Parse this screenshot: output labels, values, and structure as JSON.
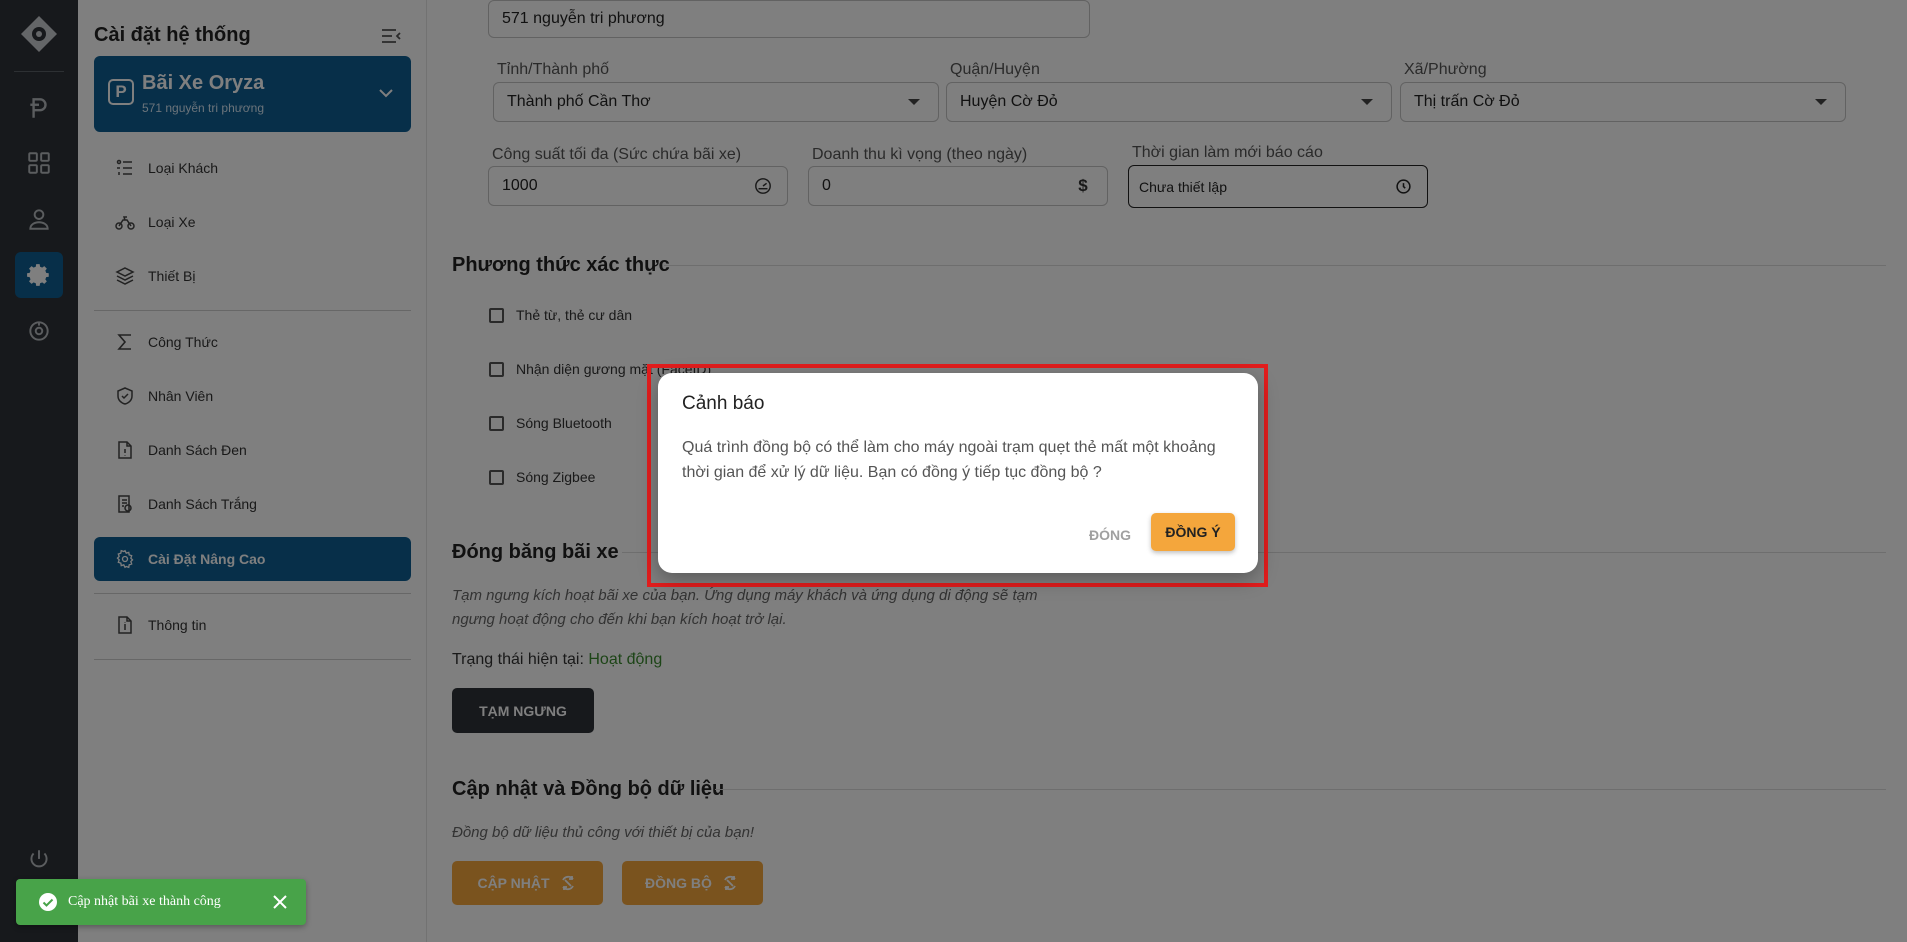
{
  "sidebar": {
    "title": "Cài đặt hệ thống",
    "lot": {
      "name": "Bãi Xe Oryza",
      "address": "571 nguyễn tri phương",
      "badge": "P"
    },
    "items": [
      {
        "label": "Loại Khách",
        "icon": "customer-type-icon"
      },
      {
        "label": "Loại Xe",
        "icon": "motorbike-icon"
      },
      {
        "label": "Thiết Bị",
        "icon": "layers-icon"
      },
      {
        "label": "Công Thức",
        "icon": "sigma-icon"
      },
      {
        "label": "Nhân Viên",
        "icon": "shield-icon"
      },
      {
        "label": "Danh Sách Đen",
        "icon": "document-alert-icon"
      },
      {
        "label": "Danh Sách Trắng",
        "icon": "document-check-icon"
      },
      {
        "label": "Cài Đặt Nâng Cao",
        "icon": "gear-icon",
        "active": true
      },
      {
        "label": "Thông tin",
        "icon": "info-doc-icon"
      }
    ]
  },
  "form": {
    "address_value": "571 nguyễn tri phương",
    "province": {
      "label": "Tỉnh/Thành phố",
      "value": "Thành phố Cần Thơ"
    },
    "district": {
      "label": "Quận/Huyện",
      "value": "Huyện Cờ Đỏ"
    },
    "ward": {
      "label": "Xã/Phường",
      "value": "Thị trấn Cờ Đỏ"
    },
    "capacity": {
      "label": "Công suất tối đa (Sức chứa bãi xe)",
      "value": "1000"
    },
    "revenue": {
      "label": "Doanh thu kì vọng (theo ngày)",
      "value": "0",
      "unit": "$"
    },
    "refresh": {
      "label": "Thời gian làm mới báo cáo",
      "value": "Chưa thiết lập"
    }
  },
  "auth": {
    "title": "Phương thức xác thực",
    "options": [
      {
        "label": "Thẻ từ, thẻ cư dân"
      },
      {
        "label": "Nhận diện gương mặt (FaceID)"
      },
      {
        "label": "Sóng Bluetooth"
      },
      {
        "label": "Sóng Zigbee"
      }
    ]
  },
  "freeze": {
    "title": "Đóng băng bãi xe",
    "description": "Tạm ngưng kích hoạt bãi xe của bạn. Ứng dụng máy khách và ứng dụng di động sẽ tạm ngưng hoạt động cho đến khi bạn kích hoạt trở lại.",
    "status_label": "Trạng thái hiện tại: ",
    "status_value": "Hoạt động",
    "button": "TẠM NGƯNG"
  },
  "sync": {
    "title": "Cập nhật và Đồng bộ dữ liệu",
    "description": "Đồng bộ dữ liệu thủ công với thiết bị của bạn!",
    "update_button": "CẬP NHẬT",
    "sync_button": "ĐỒNG BỘ"
  },
  "dialog": {
    "title": "Cảnh báo",
    "message": "Quá trình đồng bộ có thể làm cho máy ngoài trạm quẹt thẻ mất một khoảng thời gian để xử lý dữ liệu. Bạn có đồng ý tiếp tục đồng bộ ?",
    "close": "ĐÓNG",
    "agree": "ĐỒNG Ý"
  },
  "toast": {
    "message": "Cập nhật bãi xe thành công"
  },
  "colors": {
    "primary": "#0e5f93",
    "accent": "#f4a63c",
    "success": "#48a349",
    "rail": "#2f3338",
    "highlight": "#e21d1d"
  }
}
